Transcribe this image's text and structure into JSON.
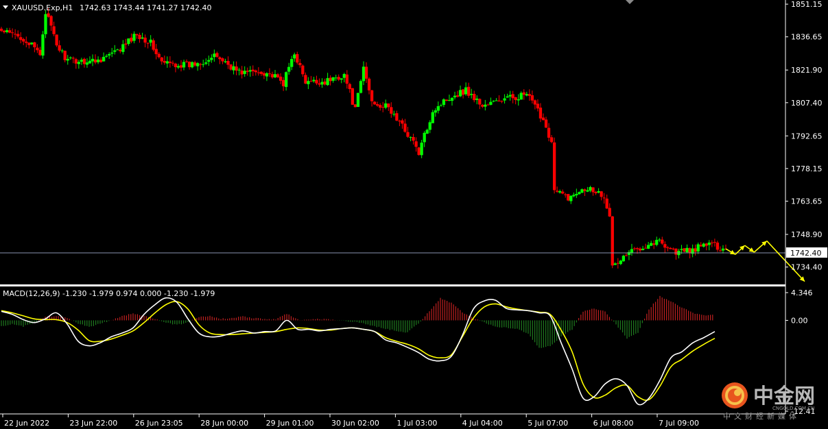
{
  "colors": {
    "background": "#000000",
    "bull_candle": "#00ff00",
    "bear_candle": "#ff0000",
    "axis_text": "#ffffff",
    "price_line": "#8a93b0",
    "macd_main": "#ffffff",
    "macd_signal": "#ffff00",
    "hist_positive": "#c02020",
    "hist_negative": "#1f7a1f",
    "arrow": "#ffff00"
  },
  "header": {
    "symbol_label": "XAUUSD.Exp,H1",
    "ohlc": "1742.63 1743.44 1741.27 1742.40",
    "dropdown_icon": "triangle-down-icon"
  },
  "macd_header": {
    "label": "MACD(12,26,9) -1.230 -1.979 0.974 0.000 -1.230 -1.979"
  },
  "current_price": "1742.40",
  "watermark": {
    "brand": "中金网",
    "domain": "CNGOLD.COM.CN",
    "tagline": "中文财经新媒体",
    "logo_icon": "cngold-logo-icon"
  },
  "chart_data": [
    {
      "type": "candlestick",
      "title": "XAUUSD.Exp,H1",
      "timeframe": "H1",
      "ylim": [
        1727.0,
        1853.0
      ],
      "y_ticks": [
        "1851.15",
        "1836.65",
        "1821.90",
        "1807.40",
        "1792.65",
        "1778.15",
        "1763.65",
        "1748.90",
        "1734.40"
      ],
      "x_ticks": [
        "22 Jun 2022",
        "23 Jun 22:00",
        "26 Jun 23:05",
        "28 Jun 00:00",
        "29 Jun 01:00",
        "30 Jun 02:00",
        "1 Jul 03:00",
        "4 Jul 04:00",
        "5 Jul 07:00",
        "6 Jul 08:00",
        "7 Jul 09:00"
      ],
      "last_price": 1742.4,
      "anchor_closes": [
        [
          0,
          1839
        ],
        [
          8,
          1836
        ],
        [
          14,
          1829
        ],
        [
          16,
          1848
        ],
        [
          20,
          1833
        ],
        [
          24,
          1826
        ],
        [
          34,
          1826
        ],
        [
          42,
          1830
        ],
        [
          49,
          1838
        ],
        [
          54,
          1834
        ],
        [
          58,
          1825
        ],
        [
          68,
          1824
        ],
        [
          78,
          1828
        ],
        [
          86,
          1821
        ],
        [
          96,
          1821
        ],
        [
          102,
          1816
        ],
        [
          106,
          1830
        ],
        [
          110,
          1816
        ],
        [
          118,
          1817
        ],
        [
          124,
          1820
        ],
        [
          128,
          1804
        ],
        [
          131,
          1823
        ],
        [
          134,
          1808
        ],
        [
          140,
          1805
        ],
        [
          148,
          1792
        ],
        [
          151,
          1785
        ],
        [
          156,
          1804
        ],
        [
          162,
          1810
        ],
        [
          168,
          1813
        ],
        [
          174,
          1806
        ],
        [
          182,
          1809
        ],
        [
          190,
          1811
        ],
        [
          196,
          1800
        ],
        [
          199,
          1790
        ],
        [
          200,
          1768
        ],
        [
          206,
          1765
        ],
        [
          210,
          1770
        ],
        [
          214,
          1769
        ],
        [
          218,
          1766
        ],
        [
          220,
          1758
        ],
        [
          221,
          1734
        ],
        [
          226,
          1740
        ],
        [
          232,
          1744
        ],
        [
          238,
          1746
        ],
        [
          244,
          1741
        ],
        [
          250,
          1742
        ],
        [
          256,
          1745
        ],
        [
          262,
          1742
        ]
      ],
      "forecast_arrows": [
        {
          "path": [
            [
              1742.5,
              0
            ],
            [
              1740,
              3
            ],
            [
              1744,
              6
            ],
            [
              1741,
              9
            ],
            [
              1746,
              13
            ],
            [
              1728,
              25
            ]
          ]
        }
      ]
    },
    {
      "type": "line",
      "title": "MACD(12,26,9)",
      "ylim": [
        -12.41,
        4.346
      ],
      "y_ticks": [
        "4.346",
        "0.00",
        "-12.41"
      ],
      "series": [
        {
          "name": "MACD",
          "values": [
            1.2,
            0.8,
            0.1,
            -0.3,
            0.2,
            1.0,
            -0.5,
            -2.8,
            -3.4,
            -3.0,
            -2.2,
            -1.7,
            -1.0,
            0.8,
            2.1,
            3.0,
            2.4,
            0.2,
            -1.7,
            -2.2,
            -2.1,
            -1.7,
            -1.4,
            -1.7,
            -1.5,
            -1.4,
            0.0,
            -1.2,
            -1.2,
            -1.4,
            -1.2,
            -1.1,
            -1.0,
            -1.2,
            -1.5,
            -2.6,
            -3.0,
            -3.6,
            -4.3,
            -5.2,
            -5.4,
            -4.8,
            -2.0,
            1.5,
            2.6,
            2.7,
            1.6,
            1.4,
            1.3,
            1.0,
            0.6,
            -3.0,
            -6.5,
            -10.4,
            -10.2,
            -8.5,
            -7.8,
            -8.7,
            -11.2,
            -10.4,
            -8.0,
            -5.0,
            -4.2,
            -3.0,
            -2.3,
            -1.5
          ]
        },
        {
          "name": "Signal",
          "values": [
            1.3,
            1.0,
            0.6,
            0.2,
            0.1,
            0.1,
            -0.3,
            -1.3,
            -2.7,
            -2.8,
            -2.5,
            -2.0,
            -1.4,
            -0.3,
            1.0,
            2.1,
            2.5,
            1.5,
            -0.6,
            -1.7,
            -1.9,
            -1.9,
            -1.8,
            -1.7,
            -1.6,
            -1.5,
            -1.2,
            -1.0,
            -1.1,
            -1.3,
            -1.3,
            -1.1,
            -1.0,
            -1.2,
            -1.5,
            -2.3,
            -2.8,
            -3.2,
            -3.8,
            -4.7,
            -5.0,
            -4.6,
            -2.2,
            0.3,
            1.8,
            2.2,
            1.8,
            1.5,
            1.3,
            1.1,
            0.8,
            -1.3,
            -4.2,
            -8.5,
            -10.3,
            -10.0,
            -9.0,
            -8.7,
            -10.2,
            -10.6,
            -8.8,
            -6.2,
            -5.2,
            -4.1,
            -3.2,
            -2.4
          ]
        },
        {
          "name": "Histogram",
          "values": [
            -0.8,
            -0.5,
            -0.8,
            -0.3,
            0.5,
            0.6,
            0.3,
            -0.4,
            -0.9,
            -0.4,
            0.0,
            0.6,
            0.9,
            0.6,
            0.2,
            -0.3,
            -0.6,
            -0.3,
            0.5,
            0.6,
            0.2,
            0.3,
            0.5,
            0.3,
            0.2,
            0.1,
            0.9,
            0.1,
            0.1,
            0.2,
            0.1,
            0.0,
            -0.2,
            -0.4,
            -0.8,
            -1.1,
            -1.4,
            -1.6,
            -0.4,
            1.2,
            3.0,
            2.3,
            1.1,
            0.3,
            -0.3,
            -0.8,
            -1.0,
            -1.1,
            -1.8,
            -3.7,
            -3.4,
            -2.2,
            -1.2,
            1.2,
            1.6,
            1.2,
            -0.6,
            -2.4,
            -1.7,
            1.5,
            3.2,
            2.6,
            1.7,
            1.0,
            0.7,
            0.8
          ]
        }
      ]
    }
  ]
}
